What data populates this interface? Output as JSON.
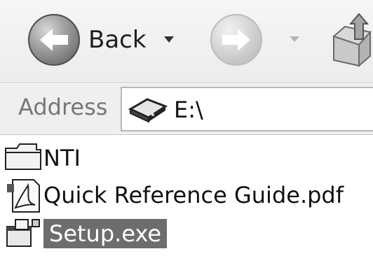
{
  "toolbar": {
    "back_label": "Back"
  },
  "address": {
    "label": "Address",
    "value": "E:\\"
  },
  "files": [
    {
      "name": "NTI",
      "icon": "folder-icon"
    },
    {
      "name": "Quick Reference Guide.pdf",
      "icon": "pdf-file-icon"
    },
    {
      "name": "Setup.exe",
      "icon": "executable-icon",
      "selected": true
    }
  ]
}
